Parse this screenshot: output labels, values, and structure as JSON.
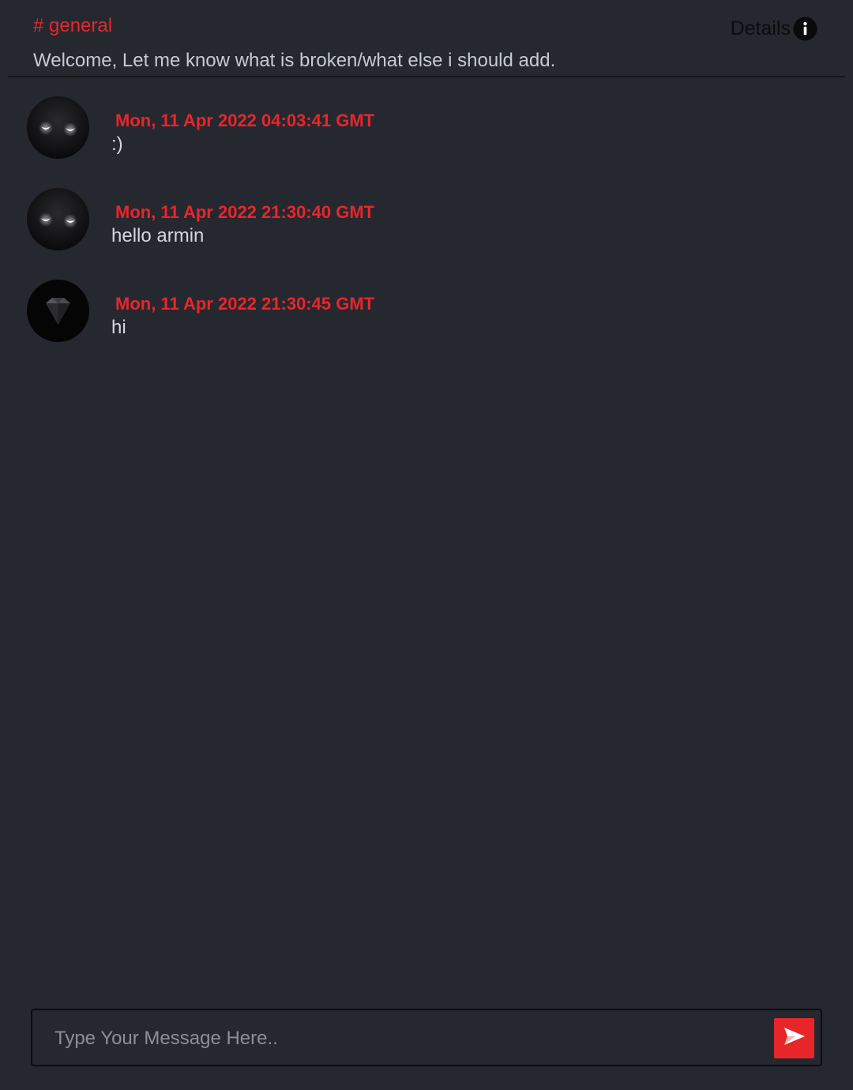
{
  "colors": {
    "background": "#262830",
    "accent": "#e8262a",
    "text": "#d4d7de",
    "divider": "#131418"
  },
  "header": {
    "channel_name": "# general",
    "description": "Welcome, Let me know what is broken/what else i should add.",
    "details_label": "Details",
    "details_icon": "info-icon"
  },
  "messages": [
    {
      "avatar": "glowing-eyes-avatar",
      "timestamp": "Mon, 11 Apr 2022 04:03:41 GMT",
      "text": ":)"
    },
    {
      "avatar": "glowing-eyes-avatar",
      "timestamp": "Mon, 11 Apr 2022 21:30:40 GMT",
      "text": "hello armin"
    },
    {
      "avatar": "diamond-avatar",
      "timestamp": "Mon, 11 Apr 2022 21:30:45 GMT",
      "text": "hi"
    }
  ],
  "composer": {
    "placeholder": "Type Your Message Here..",
    "value": "",
    "send_icon": "send-icon"
  }
}
